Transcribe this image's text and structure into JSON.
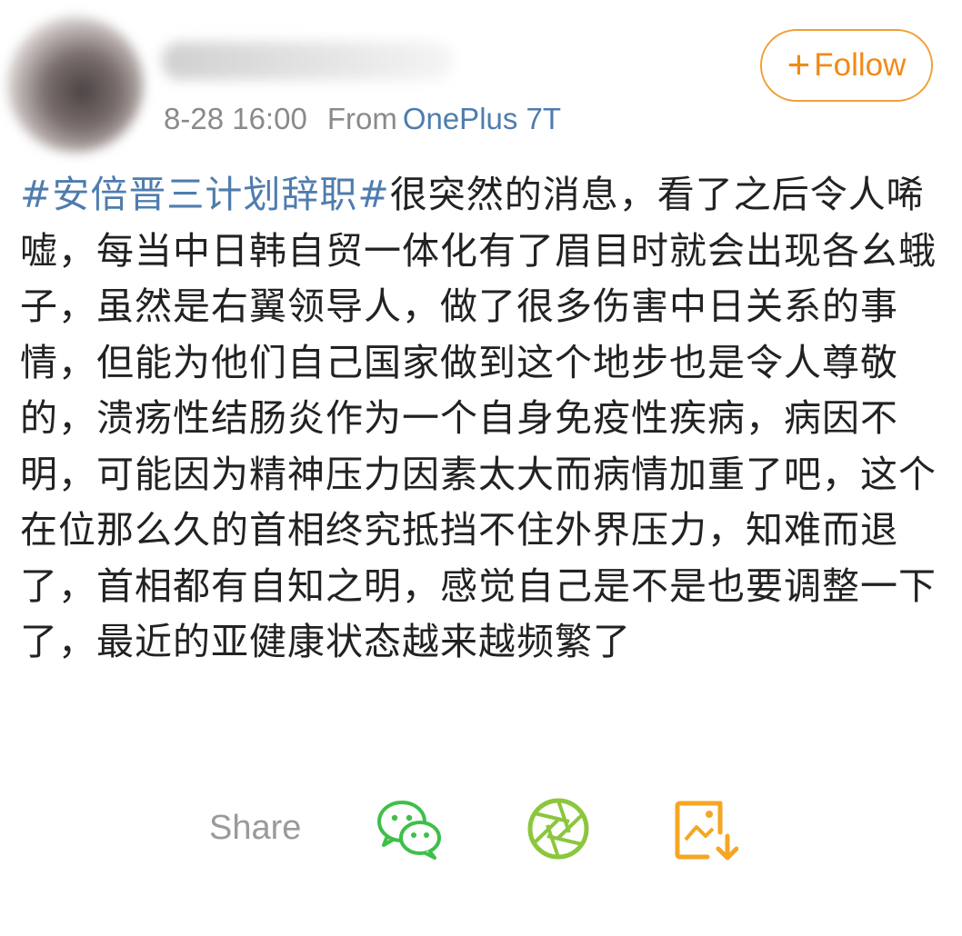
{
  "post": {
    "author_meta": {
      "time": "8-28 16:00",
      "from_label": "From",
      "device": "OnePlus 7T"
    },
    "follow_button": {
      "plus": "+",
      "label": "Follow"
    },
    "hashtag": "#安倍晋三计划辞职#",
    "body": "很突然的消息，看了之后令人唏嘘，每当中日韩自贸一体化有了眉目时就会出现各幺蛾子，虽然是右翼领导人，做了很多伤害中日关系的事情，但能为他们自己国家做到这个地步也是令人尊敬的，溃疡性结肠炎作为一个自身免疫性疾病，病因不明，可能因为精神压力因素太大而病情加重了吧，这个在位那么久的首相终究抵挡不住外界压力，知难而退了，首相都有自知之明，感觉自己是不是也要调整一下了，最近的亚健康状态越来越频繁了"
  },
  "share_bar": {
    "label": "Share",
    "icons": [
      "wechat-icon",
      "moments-icon",
      "save-image-icon"
    ]
  },
  "colors": {
    "link_blue": "#4f7cae",
    "follow_orange": "#f08a16",
    "wechat_green": "#3fbf4a",
    "moments_green": "#8cc63e",
    "save_orange": "#f5a623"
  }
}
